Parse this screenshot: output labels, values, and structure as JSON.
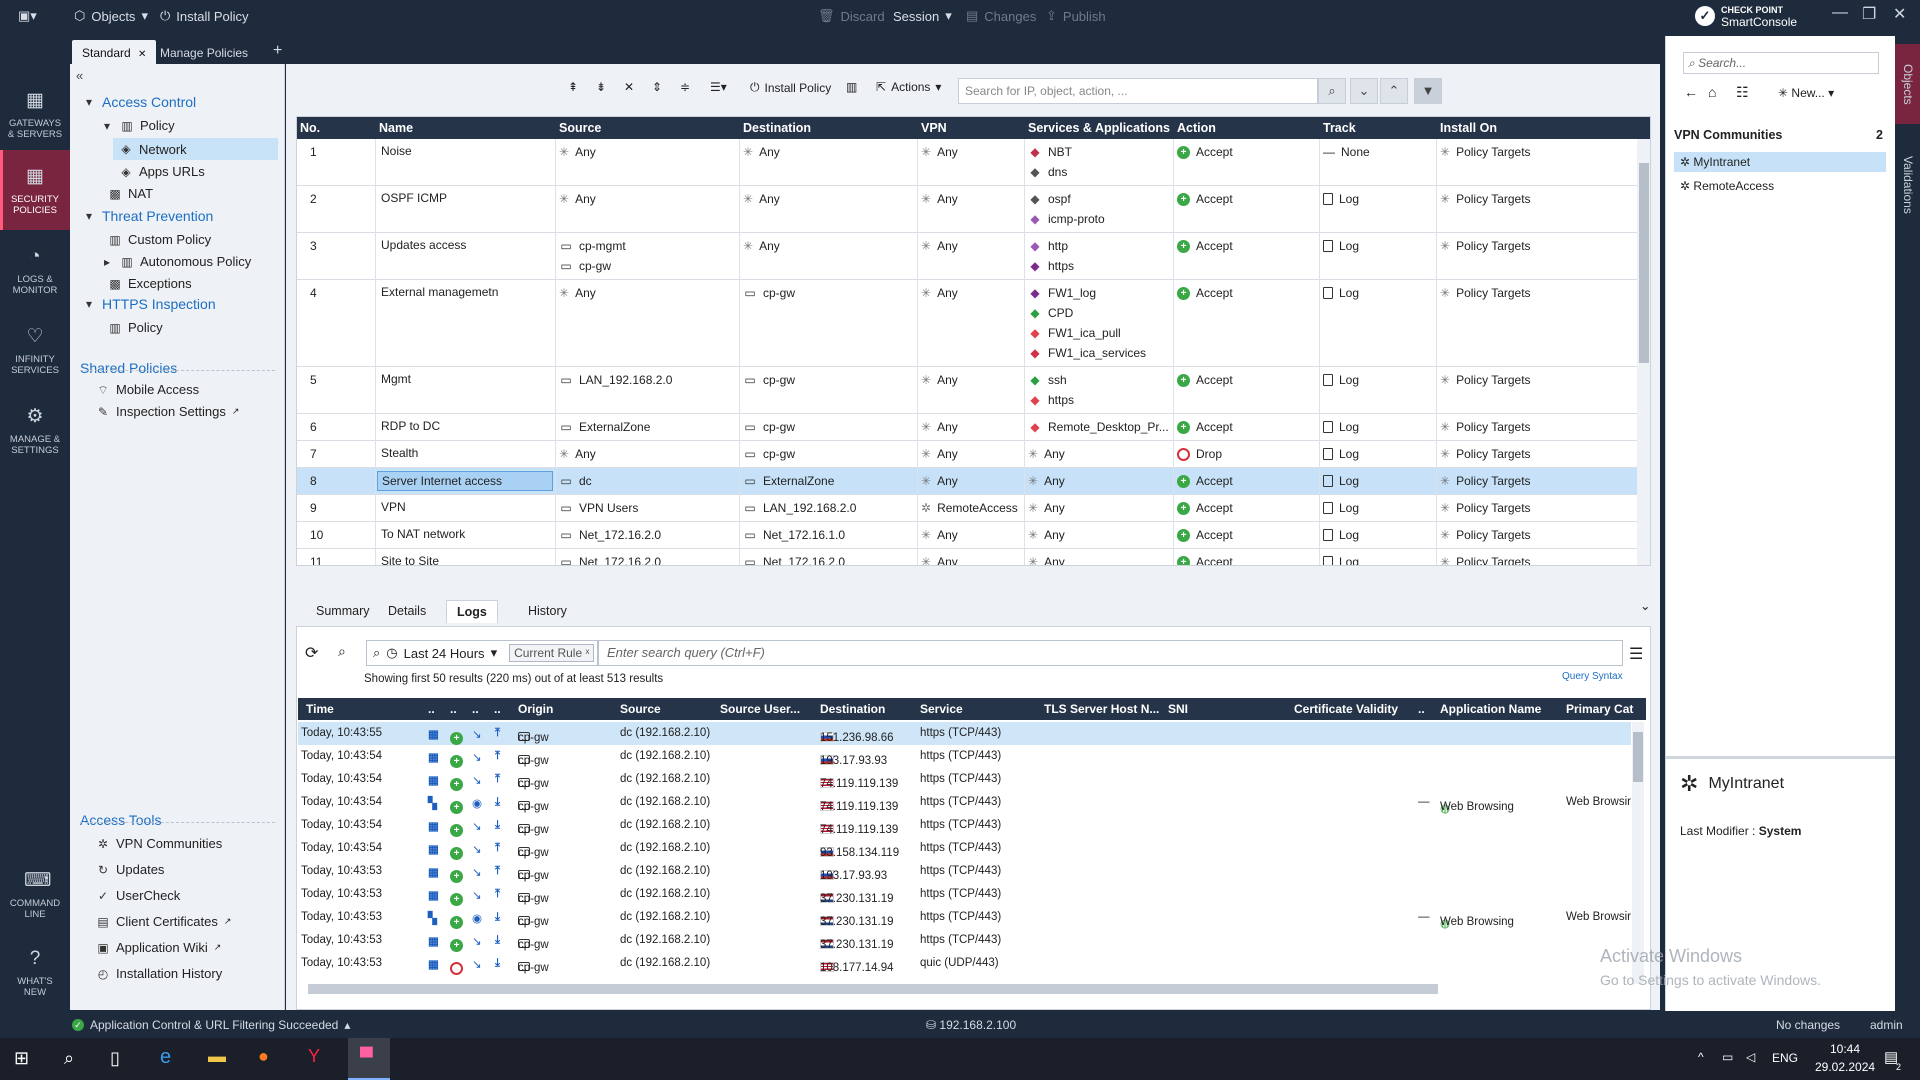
{
  "titlebar": {
    "objects": "Objects",
    "install_policy": "Install Policy",
    "discard": "Discard",
    "session": "Session",
    "changes": "Changes",
    "publish": "Publish",
    "brand_top": "CHECK POINT",
    "brand_bottom": "SmartConsole"
  },
  "tabs": [
    "Standard",
    "Manage Policies"
  ],
  "leftnav": [
    {
      "label1": "GATEWAYS",
      "label2": "& SERVERS"
    },
    {
      "label1": "SECURITY",
      "label2": "POLICIES"
    },
    {
      "label1": "LOGS &",
      "label2": "MONITOR"
    },
    {
      "label1": "INFINITY",
      "label2": "SERVICES"
    },
    {
      "label1": "MANAGE &",
      "label2": "SETTINGS"
    },
    {
      "label1": "COMMAND",
      "label2": "LINE"
    },
    {
      "label1": "WHAT'S",
      "label2": "NEW"
    }
  ],
  "tree": {
    "access_control": "Access Control",
    "policy": "Policy",
    "network": "Network",
    "apps_urls": "Apps URLs",
    "nat": "NAT",
    "threat_prevention": "Threat Prevention",
    "custom_policy": "Custom Policy",
    "autonomous_policy": "Autonomous Policy",
    "exceptions": "Exceptions",
    "https_inspection": "HTTPS Inspection",
    "https_policy": "Policy",
    "shared_policies": "Shared Policies",
    "mobile_access": "Mobile Access",
    "inspection_settings": "Inspection Settings",
    "access_tools": "Access Tools",
    "vpn_communities": "VPN Communities",
    "updates": "Updates",
    "usercheck": "UserCheck",
    "client_certificates": "Client Certificates",
    "application_wiki": "Application Wiki",
    "installation_history": "Installation History"
  },
  "toolbar": {
    "install_policy": "Install Policy",
    "actions": "Actions",
    "search_placeholder": "Search for IP, object, action, ..."
  },
  "rules_header": [
    "No.",
    "Name",
    "Source",
    "Destination",
    "VPN",
    "Services & Applications",
    "Action",
    "Track",
    "Install On"
  ],
  "rules": [
    {
      "no": "1",
      "name": "Noise",
      "source": [
        "Any"
      ],
      "dest": [
        "Any"
      ],
      "vpn": "Any",
      "services": [
        "NBT",
        "dns"
      ],
      "action": "Accept",
      "track": "None",
      "install": "Policy Targets"
    },
    {
      "no": "2",
      "name": "OSPF ICMP",
      "source": [
        "Any"
      ],
      "dest": [
        "Any"
      ],
      "vpn": "Any",
      "services": [
        "ospf",
        "icmp-proto"
      ],
      "action": "Accept",
      "track": "Log",
      "install": "Policy Targets"
    },
    {
      "no": "3",
      "name": "Updates access",
      "source": [
        "cp-mgmt",
        "cp-gw"
      ],
      "dest": [
        "Any"
      ],
      "vpn": "Any",
      "services": [
        "http",
        "https"
      ],
      "action": "Accept",
      "track": "Log",
      "install": "Policy Targets"
    },
    {
      "no": "4",
      "name": "External managemetn",
      "source": [
        "Any"
      ],
      "dest": [
        "cp-gw"
      ],
      "vpn": "Any",
      "services": [
        "FW1_log",
        "CPD",
        "FW1_ica_pull",
        "FW1_ica_services"
      ],
      "action": "Accept",
      "track": "Log",
      "install": "Policy Targets"
    },
    {
      "no": "5",
      "name": "Mgmt",
      "source": [
        "LAN_192.168.2.0"
      ],
      "dest": [
        "cp-gw"
      ],
      "vpn": "Any",
      "services": [
        "ssh",
        "https"
      ],
      "action": "Accept",
      "track": "Log",
      "install": "Policy Targets"
    },
    {
      "no": "6",
      "name": "RDP to DC",
      "source": [
        "ExternalZone"
      ],
      "dest": [
        "cp-gw"
      ],
      "vpn": "Any",
      "services": [
        "Remote_Desktop_Pr..."
      ],
      "action": "Accept",
      "track": "Log",
      "install": "Policy Targets"
    },
    {
      "no": "7",
      "name": "Stealth",
      "source": [
        "Any"
      ],
      "dest": [
        "cp-gw"
      ],
      "vpn": "Any",
      "services": [
        "Any"
      ],
      "action": "Drop",
      "track": "Log",
      "install": "Policy Targets"
    },
    {
      "no": "8",
      "name": "Server Internet access",
      "source": [
        "dc"
      ],
      "dest": [
        "ExternalZone"
      ],
      "vpn": "Any",
      "services": [
        "Any"
      ],
      "action": "Accept",
      "track": "Log",
      "install": "Policy Targets"
    },
    {
      "no": "9",
      "name": "VPN",
      "source": [
        "VPN Users"
      ],
      "dest": [
        "LAN_192.168.2.0"
      ],
      "vpn": "RemoteAccess",
      "services": [
        "Any"
      ],
      "action": "Accept",
      "track": "Log",
      "install": "Policy Targets"
    },
    {
      "no": "10",
      "name": "To NAT network",
      "source": [
        "Net_172.16.2.0"
      ],
      "dest": [
        "Net_172.16.1.0"
      ],
      "vpn": "Any",
      "services": [
        "Any"
      ],
      "action": "Accept",
      "track": "Log",
      "install": "Policy Targets"
    },
    {
      "no": "11",
      "name": "Site to Site",
      "source": [
        "Net_172.16.2.0"
      ],
      "dest": [
        "Net_172.16.2.0"
      ],
      "vpn": "Any",
      "services": [
        "Any"
      ],
      "action": "Accept",
      "track": "Log",
      "install": "Policy Targets"
    }
  ],
  "lower_tabs": [
    "Summary",
    "Details",
    "Logs",
    "History"
  ],
  "logs": {
    "time_range": "Last 24 Hours",
    "current_rule": "Current Rule",
    "query_placeholder": "Enter search query (Ctrl+F)",
    "summary": "Showing first 50 results (220 ms) out of at least 513 results",
    "query_syntax": "Query Syntax",
    "header": [
      "Time",
      "..",
      "..",
      "..",
      "..",
      "Origin",
      "Source",
      "Source User...",
      "Destination",
      "Service",
      "TLS Server Host N...",
      "SNI",
      "Certificate Validity",
      "..",
      "Application Name",
      "Primary Cat"
    ],
    "rows": [
      {
        "time": "Today, 10:43:55",
        "origin": "cp-gw",
        "source": "dc (192.168.2.10)",
        "dest": "151.236.98.66",
        "flag": "ru",
        "service": "https (TCP/443)",
        "app": "",
        "cat": "",
        "dir": "up",
        "blocked": false
      },
      {
        "time": "Today, 10:43:54",
        "origin": "cp-gw",
        "source": "dc (192.168.2.10)",
        "dest": "193.17.93.93",
        "flag": "ru",
        "service": "https (TCP/443)",
        "app": "",
        "cat": "",
        "dir": "up",
        "blocked": false
      },
      {
        "time": "Today, 10:43:54",
        "origin": "cp-gw",
        "source": "dc (192.168.2.10)",
        "dest": "74.119.119.139",
        "flag": "us",
        "service": "https (TCP/443)",
        "app": "",
        "cat": "",
        "dir": "up",
        "blocked": false
      },
      {
        "time": "Today, 10:43:54",
        "origin": "cp-gw",
        "source": "dc (192.168.2.10)",
        "dest": "74.119.119.139",
        "flag": "us",
        "service": "https (TCP/443)",
        "app": "Web Browsing",
        "cat": "Web Browsir",
        "dir": "down",
        "blocked": false
      },
      {
        "time": "Today, 10:43:54",
        "origin": "cp-gw",
        "source": "dc (192.168.2.10)",
        "dest": "74.119.119.139",
        "flag": "us",
        "service": "https (TCP/443)",
        "app": "",
        "cat": "",
        "dir": "down",
        "blocked": false
      },
      {
        "time": "Today, 10:43:54",
        "origin": "cp-gw",
        "source": "dc (192.168.2.10)",
        "dest": "93.158.134.119",
        "flag": "ru",
        "service": "https (TCP/443)",
        "app": "",
        "cat": "",
        "dir": "up",
        "blocked": false
      },
      {
        "time": "Today, 10:43:53",
        "origin": "cp-gw",
        "source": "dc (192.168.2.10)",
        "dest": "193.17.93.93",
        "flag": "ru",
        "service": "https (TCP/443)",
        "app": "",
        "cat": "",
        "dir": "up",
        "blocked": false
      },
      {
        "time": "Today, 10:43:53",
        "origin": "cp-gw",
        "source": "dc (192.168.2.10)",
        "dest": "37.230.131.19",
        "flag": "nl",
        "service": "https (TCP/443)",
        "app": "",
        "cat": "",
        "dir": "up",
        "blocked": false
      },
      {
        "time": "Today, 10:43:53",
        "origin": "cp-gw",
        "source": "dc (192.168.2.10)",
        "dest": "37.230.131.19",
        "flag": "nl",
        "service": "https (TCP/443)",
        "app": "Web Browsing",
        "cat": "Web Browsir",
        "dir": "down",
        "blocked": false
      },
      {
        "time": "Today, 10:43:53",
        "origin": "cp-gw",
        "source": "dc (192.168.2.10)",
        "dest": "37.230.131.19",
        "flag": "nl",
        "service": "https (TCP/443)",
        "app": "",
        "cat": "",
        "dir": "down",
        "blocked": false
      },
      {
        "time": "Today, 10:43:53",
        "origin": "cp-gw",
        "source": "dc (192.168.2.10)",
        "dest": "108.177.14.94",
        "flag": "us",
        "service": "quic (UDP/443)",
        "app": "",
        "cat": "",
        "dir": "down",
        "blocked": true
      }
    ]
  },
  "right_panel": {
    "search_placeholder": "Search...",
    "new_label": "New...",
    "section_title": "VPN Communities",
    "section_count": "2",
    "items": [
      "MyIntranet",
      "RemoteAccess"
    ],
    "detail_title": "MyIntranet",
    "modifier_label": "Last Modifier :",
    "modifier_value": "System",
    "side_tabs": [
      "Objects",
      "Validations"
    ]
  },
  "status": {
    "message": "Application Control & URL Filtering Succeeded",
    "server": "192.168.2.100",
    "changes": "No changes",
    "user": "admin"
  },
  "watermark": {
    "line1": "Activate Windows",
    "line2": "Go to Settings to activate Windows."
  },
  "taskbar": {
    "lang": "ENG",
    "time": "10:44",
    "date": "29.02.2024",
    "notifications": "2"
  },
  "colors": {
    "chrome": "#1e2b3d",
    "accent_active": "#7a2540",
    "link_blue": "#1d6fc4",
    "accept_green": "#3aa845",
    "drop_red": "#d6303a",
    "selection": "#c7e2f8"
  }
}
